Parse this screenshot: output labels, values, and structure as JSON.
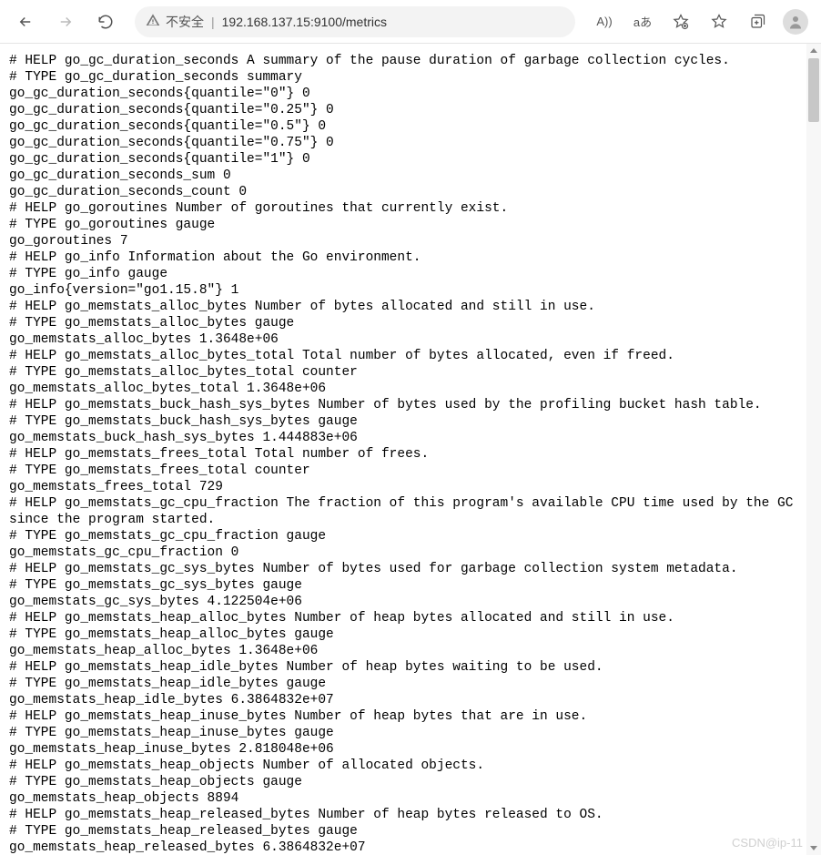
{
  "toolbar": {
    "security_label": "不安全",
    "url": "192.168.137.15:9100/metrics",
    "read_aloud": "A))",
    "translate": "aあ"
  },
  "metrics_lines": [
    "# HELP go_gc_duration_seconds A summary of the pause duration of garbage collection cycles.",
    "# TYPE go_gc_duration_seconds summary",
    "go_gc_duration_seconds{quantile=\"0\"} 0",
    "go_gc_duration_seconds{quantile=\"0.25\"} 0",
    "go_gc_duration_seconds{quantile=\"0.5\"} 0",
    "go_gc_duration_seconds{quantile=\"0.75\"} 0",
    "go_gc_duration_seconds{quantile=\"1\"} 0",
    "go_gc_duration_seconds_sum 0",
    "go_gc_duration_seconds_count 0",
    "# HELP go_goroutines Number of goroutines that currently exist.",
    "# TYPE go_goroutines gauge",
    "go_goroutines 7",
    "# HELP go_info Information about the Go environment.",
    "# TYPE go_info gauge",
    "go_info{version=\"go1.15.8\"} 1",
    "# HELP go_memstats_alloc_bytes Number of bytes allocated and still in use.",
    "# TYPE go_memstats_alloc_bytes gauge",
    "go_memstats_alloc_bytes 1.3648e+06",
    "# HELP go_memstats_alloc_bytes_total Total number of bytes allocated, even if freed.",
    "# TYPE go_memstats_alloc_bytes_total counter",
    "go_memstats_alloc_bytes_total 1.3648e+06",
    "# HELP go_memstats_buck_hash_sys_bytes Number of bytes used by the profiling bucket hash table.",
    "# TYPE go_memstats_buck_hash_sys_bytes gauge",
    "go_memstats_buck_hash_sys_bytes 1.444883e+06",
    "# HELP go_memstats_frees_total Total number of frees.",
    "# TYPE go_memstats_frees_total counter",
    "go_memstats_frees_total 729",
    "# HELP go_memstats_gc_cpu_fraction The fraction of this program's available CPU time used by the GC since the program started.",
    "# TYPE go_memstats_gc_cpu_fraction gauge",
    "go_memstats_gc_cpu_fraction 0",
    "# HELP go_memstats_gc_sys_bytes Number of bytes used for garbage collection system metadata.",
    "# TYPE go_memstats_gc_sys_bytes gauge",
    "go_memstats_gc_sys_bytes 4.122504e+06",
    "# HELP go_memstats_heap_alloc_bytes Number of heap bytes allocated and still in use.",
    "# TYPE go_memstats_heap_alloc_bytes gauge",
    "go_memstats_heap_alloc_bytes 1.3648e+06",
    "# HELP go_memstats_heap_idle_bytes Number of heap bytes waiting to be used.",
    "# TYPE go_memstats_heap_idle_bytes gauge",
    "go_memstats_heap_idle_bytes 6.3864832e+07",
    "# HELP go_memstats_heap_inuse_bytes Number of heap bytes that are in use.",
    "# TYPE go_memstats_heap_inuse_bytes gauge",
    "go_memstats_heap_inuse_bytes 2.818048e+06",
    "# HELP go_memstats_heap_objects Number of allocated objects.",
    "# TYPE go_memstats_heap_objects gauge",
    "go_memstats_heap_objects 8894",
    "# HELP go_memstats_heap_released_bytes Number of heap bytes released to OS.",
    "# TYPE go_memstats_heap_released_bytes gauge",
    "go_memstats_heap_released_bytes 6.3864832e+07"
  ],
  "watermark": "CSDN@ip-11"
}
